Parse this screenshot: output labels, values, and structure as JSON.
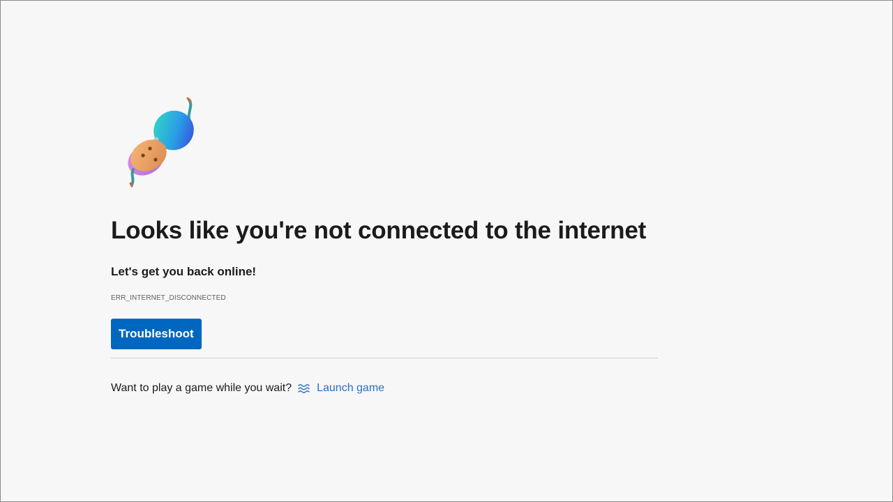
{
  "error_page": {
    "headline": "Looks like you're not connected to the internet",
    "subtitle": "Let's get you back online!",
    "error_code": "ERR_INTERNET_DISCONNECTED",
    "troubleshoot_label": "Troubleshoot",
    "game_prompt": "Want to play a game while you wait?",
    "launch_game_label": "Launch game",
    "illustration_icon": "unplugged-cable-icon",
    "game_icon": "surf-waves-icon"
  },
  "colors": {
    "background": "#f7f7f7",
    "primary_button": "#0067c0",
    "link": "#2a6fc9",
    "divider": "#cfcfcf"
  }
}
